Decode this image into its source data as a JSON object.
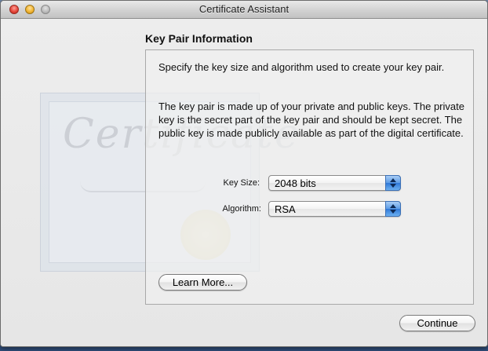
{
  "window": {
    "title": "Certificate Assistant"
  },
  "section": {
    "title": "Key Pair Information"
  },
  "panel": {
    "paragraph1": "Specify the key size and algorithm used to create your key pair.",
    "paragraph2": "The key pair is made up of your private and public keys. The private key is the secret part of the key pair and should be kept secret. The public key is made publicly available as part of the digital certificate."
  },
  "fields": {
    "key_size": {
      "label": "Key Size:",
      "value": "2048 bits"
    },
    "algorithm": {
      "label": "Algorithm:",
      "value": "RSA"
    }
  },
  "buttons": {
    "learn_more": "Learn More...",
    "continue": "Continue"
  },
  "background": {
    "script_text": "Certificate"
  },
  "icons": {
    "close": "close-icon",
    "minimize": "minimize-icon",
    "zoom": "zoom-icon",
    "popup_arrows": "chevron-updown-icon"
  },
  "colors": {
    "accent": "#3b78d8",
    "close": "#e5473a",
    "minimize": "#f2b533",
    "zoom_disabled": "#b9b9b9"
  }
}
